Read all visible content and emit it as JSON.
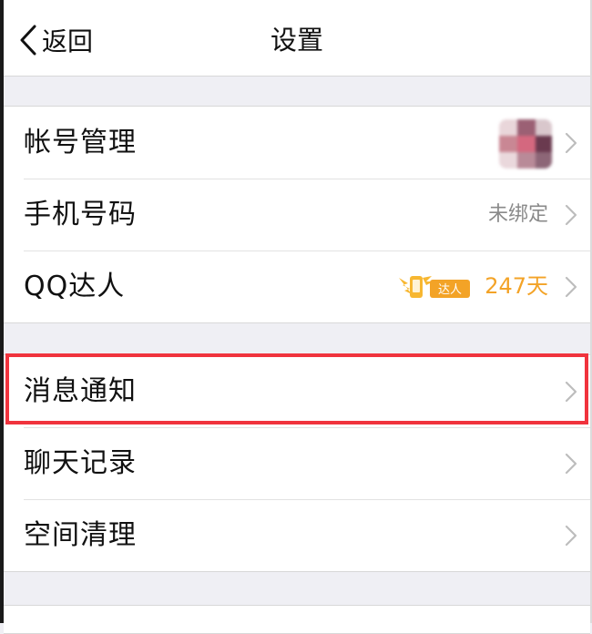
{
  "navbar": {
    "back_label": "返回",
    "title": "设置"
  },
  "groups": [
    {
      "rows": [
        {
          "label": "帐号管理",
          "value": ""
        },
        {
          "label": "手机号码",
          "value": "未绑定"
        },
        {
          "label": "QQ达人",
          "value": "247天",
          "badge_text": "达人"
        }
      ]
    },
    {
      "rows": [
        {
          "label": "消息通知",
          "value": "",
          "highlighted": true
        },
        {
          "label": "聊天记录",
          "value": ""
        },
        {
          "label": "空间清理",
          "value": ""
        }
      ]
    }
  ],
  "colors": {
    "highlight": "#f0333d",
    "accent": "#f3a327",
    "background": "#efeff4"
  },
  "icons": {
    "back": "chevron-left-icon",
    "disclosure": "chevron-right-icon",
    "badge": "qq-master-badge-icon"
  }
}
